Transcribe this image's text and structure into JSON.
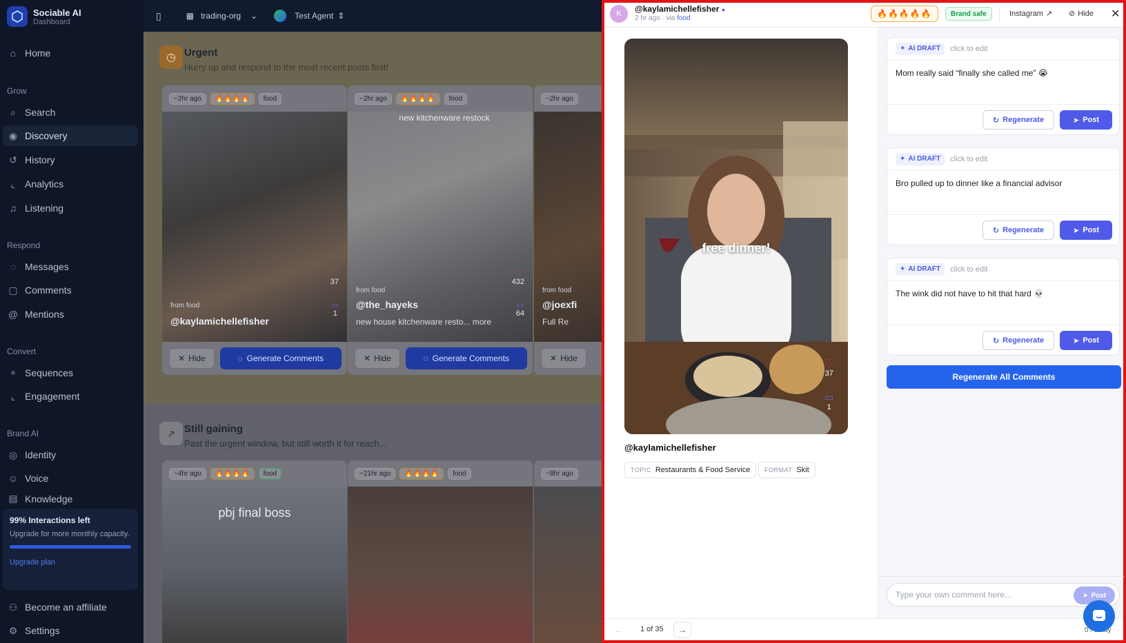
{
  "app": {
    "title": "Sociable AI",
    "subtitle": "Dashboard"
  },
  "topbar": {
    "org": "trading-org",
    "agent": "Test Agent"
  },
  "sidebar": {
    "home": "Home",
    "sections": [
      {
        "title": "Grow",
        "items": [
          "Search",
          "Discovery",
          "History",
          "Analytics",
          "Listening"
        ]
      },
      {
        "title": "Respond",
        "items": [
          "Messages",
          "Comments",
          "Mentions"
        ]
      },
      {
        "title": "Convert",
        "items": [
          "Sequences",
          "Engagement"
        ]
      },
      {
        "title": "Brand AI",
        "items": [
          "Identity",
          "Voice",
          "Knowledge"
        ]
      }
    ],
    "upgrade": {
      "title": "99% Interactions left",
      "desc": "Upgrade for more monthly capacity.",
      "link": "Upgrade plan",
      "fill_fraction": 1.0
    },
    "affiliate": "Become an affiliate",
    "settings": "Settings"
  },
  "urgent": {
    "title": "Urgent",
    "subtitle": "Hurry up and respond to the most recent posts first!",
    "cards": [
      {
        "time": "~2hr ago",
        "topic": "food",
        "from": "from food",
        "handle": "@kaylamichellefisher",
        "likes": "37",
        "comments": "1",
        "hide": "Hide",
        "gen": "Generate Comments"
      },
      {
        "time": "~2hr ago",
        "topic": "food",
        "from": "from food",
        "handle": "@the_hayeks",
        "caption": "new house kitchenware resto...",
        "more": "more",
        "overlay": "new kitchenware restock",
        "likes": "432",
        "comments": "64",
        "hide": "Hide",
        "gen": "Generate Comments"
      },
      {
        "time": "~2hr ago",
        "from": "from food",
        "handle": "@joexfi",
        "caption": "Full Re",
        "hide": "Hide"
      }
    ]
  },
  "gaining": {
    "title": "Still gaining",
    "subtitle": "Past the urgent window, but still worth it for reach...",
    "cards": [
      {
        "time": "~4hr ago",
        "topic": "food",
        "overlay": "pbj final boss"
      },
      {
        "time": "~21hr ago",
        "topic": "food"
      },
      {
        "time": "~8hr ago"
      }
    ]
  },
  "panel": {
    "avatar": "K",
    "handle": "@kaylamichellefisher",
    "meta": "2 hr ago · via",
    "meta_topic": "food",
    "fire": "🔥🔥🔥🔥🔥",
    "brand_safe": "Brand safe",
    "instagram": "Instagram",
    "hide": "Hide",
    "video_overlay": "free dinner!",
    "video_likes": "37",
    "video_comments": "1",
    "video_handle": "@kaylamichellefisher",
    "topic_key": "TOPIC",
    "topic_val": "Restaurants & Food Service",
    "format_key": "FORMAT",
    "format_val": "Skit",
    "drafts": [
      {
        "chip": "AI DRAFT",
        "edit": "click to edit",
        "text": "Mom really said “finally she called me” 😭",
        "regen": "Regenerate",
        "post": "Post"
      },
      {
        "chip": "AI DRAFT",
        "edit": "click to edit",
        "text": "Bro pulled up to dinner like a financial advisor",
        "regen": "Regenerate",
        "post": "Post"
      },
      {
        "chip": "AI DRAFT",
        "edit": "click to edit",
        "text": "The wink did not have to hit that hard 💀",
        "regen": "Regenerate",
        "post": "Post"
      }
    ],
    "regen_all": "Regenerate All Comments",
    "own_placeholder": "Type your own comment here...",
    "own_post": "Post",
    "page": "1 of 35",
    "today": "0 / today"
  },
  "colors": {
    "accent": "#2563eb",
    "post": "#4f5be8",
    "highlight_border": "#e01515"
  }
}
